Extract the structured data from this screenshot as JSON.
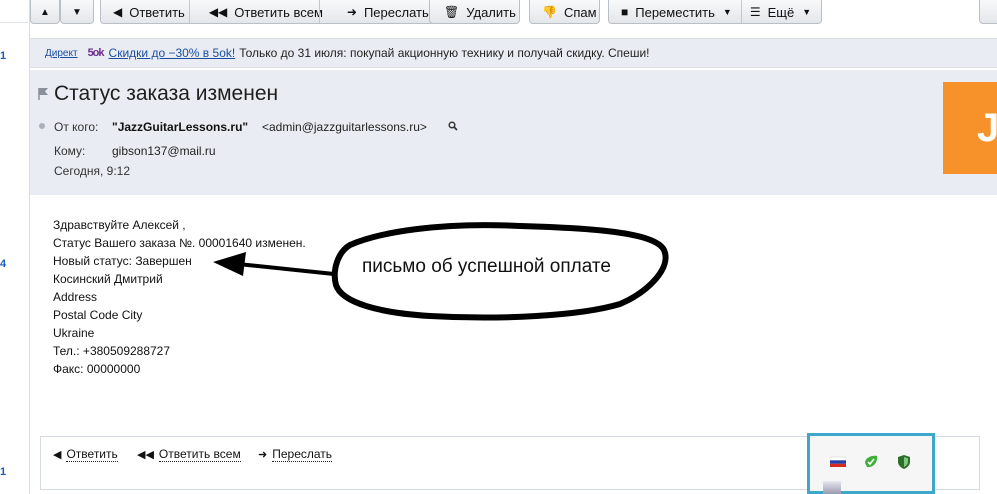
{
  "toolbar": {
    "reply": "Ответить",
    "reply_all": "Ответить всем",
    "forward": "Переслать",
    "delete": "Удалить",
    "spam": "Спам",
    "move": "Переместить",
    "more": "Ещё"
  },
  "left_strip": {
    "counts": [
      "1",
      "4",
      "1"
    ]
  },
  "ad": {
    "label": "Директ",
    "logo": "5ok",
    "link": "Скидки до −30% в 5ok!",
    "text": "Только до 31 июля: покупай акционную технику и получай скидку. Спеши!"
  },
  "message": {
    "subject": "Статус заказа изменен",
    "from_label": "От кого:",
    "from_name": "\"JazzGuitarLessons.ru\"",
    "from_email": "<admin@jazzguitarlessons.ru>",
    "to_label": "Кому:",
    "to_value": "gibson137@mail.ru",
    "date": "Сегодня, 9:12",
    "avatar_letter": "J",
    "body": [
      "Здравствуйте Алексей ,",
      "Статус Вашего заказа №. 00001640 изменен.",
      "Новый статус: Завершен",
      "Косинский Дмитрий",
      "Address",
      "Postal Code City",
      "Ukraine",
      "Тел.: +380509288727",
      "Факс: 00000000"
    ]
  },
  "annotation": {
    "text": "письмо об успешной оплате"
  },
  "reply_bar": {
    "reply": "Ответить",
    "reply_all": "Ответить всем",
    "forward": "Переслать"
  },
  "colors": {
    "header_bg": "#e9edf3",
    "avatar_bg": "#f7922b",
    "link": "#1a4d9e",
    "tray_border": "#3fa6cc"
  }
}
